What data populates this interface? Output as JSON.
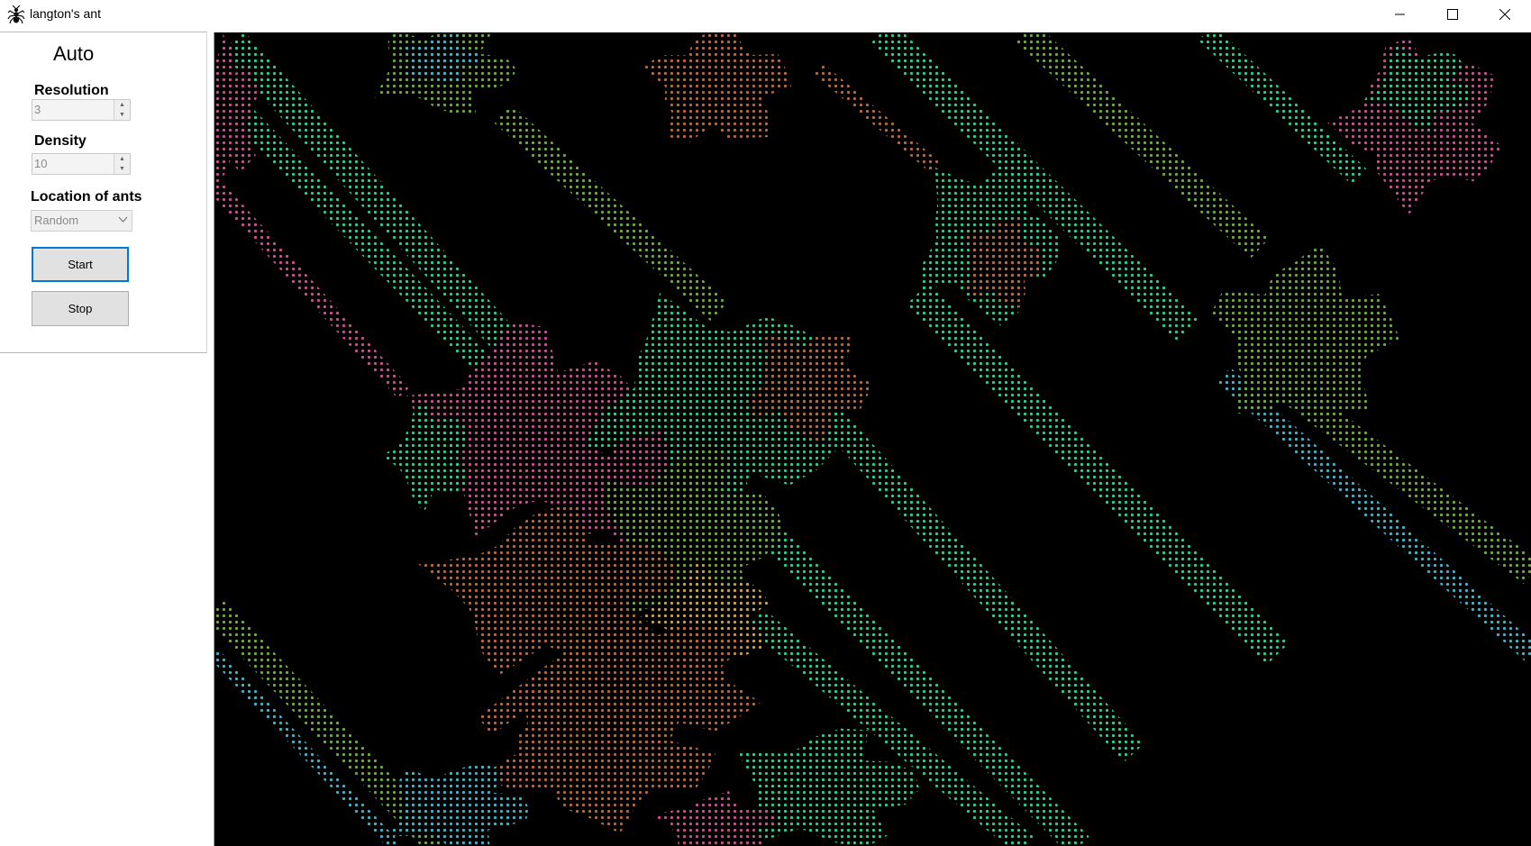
{
  "window": {
    "title": "langton's ant",
    "icon": "ant-icon",
    "controls": [
      "minimize-icon",
      "maximize-icon",
      "close-icon"
    ]
  },
  "panel": {
    "mode_label": "Auto",
    "resolution": {
      "label": "Resolution",
      "value": "3"
    },
    "density": {
      "label": "Density",
      "value": "10"
    },
    "location": {
      "label": "Location of ants",
      "selected": "Random"
    },
    "start_label": "Start",
    "stop_label": "Stop"
  },
  "simulation": {
    "background": "#000000",
    "colors": [
      "#27d08f",
      "#3fbf6a",
      "#7aa83c",
      "#c8508f",
      "#b8683c",
      "#e08a5a",
      "#3fb3c8",
      "#c9a04a"
    ]
  }
}
